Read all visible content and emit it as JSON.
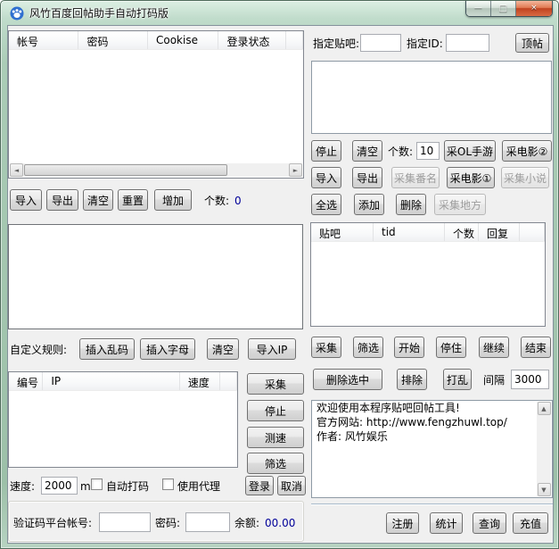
{
  "window": {
    "title": "风竹百度回帖助手自动打码版",
    "controls": {
      "minimize": "—",
      "maximize": "□",
      "close": "×"
    }
  },
  "icons": {
    "scroll_left": "◄",
    "scroll_right": "►",
    "scroll_up": "▲",
    "scroll_down": "▼"
  },
  "left": {
    "account_list": {
      "headers": [
        "帐号",
        "密码",
        "Cookise",
        "登录状态"
      ]
    },
    "account_actions": {
      "import": "导入",
      "export": "导出",
      "clear": "清空",
      "reset": "重置",
      "add": "增加",
      "count_label": "个数:",
      "count_value": "0"
    },
    "rules": {
      "label": "自定义规则:",
      "insert_garbled": "插入乱码",
      "insert_letters": "插入字母",
      "clear": "清空",
      "import_ip": "导入IP"
    },
    "ip_list": {
      "headers": [
        "编号",
        "IP",
        "速度"
      ]
    },
    "ip_actions": {
      "collect": "采集",
      "stop": "停止",
      "speed_test": "测速",
      "filter": "筛选"
    },
    "login_row": {
      "speed_label": "速度:",
      "speed_value": "2000",
      "speed_unit": "ms",
      "auto_captcha_label": "自动打码",
      "use_proxy_label": "使用代理",
      "login": "登录",
      "cancel": "取消"
    },
    "captcha_platform": {
      "account_label": "验证码平台帐号:",
      "password_label": "密码:",
      "balance_label": "余额:",
      "balance_value": "00.00"
    }
  },
  "right": {
    "target": {
      "tieba_label": "指定贴吧:",
      "id_label": "指定ID:",
      "top_button": "顶帖"
    },
    "collect_row1": {
      "stop": "停止",
      "clear": "清空",
      "count_label": "个数:",
      "count_value": "10",
      "collect_ol_mobile": "采OL手游",
      "collect_movie2": "采电影②"
    },
    "collect_row2": {
      "import": "导入",
      "export": "导出",
      "collect_anime": "采集番名",
      "collect_movie1": "采电影①",
      "collect_novel": "采集小说"
    },
    "collect_row3": {
      "select_all": "全选",
      "add": "添加",
      "delete": "删除",
      "collect_place": "采集地方"
    },
    "thread_list": {
      "headers": [
        "贴吧",
        "tid",
        "个数",
        "回复"
      ]
    },
    "run_row": {
      "collect": "采集",
      "filter": "筛选",
      "start": "开始",
      "pause": "停住",
      "resume": "继续",
      "end": "结束"
    },
    "manage_row": {
      "delete_selected": "删除选中",
      "exclude": "排除",
      "shuffle": "打乱",
      "interval_label": "间隔",
      "interval_value": "3000"
    },
    "log": {
      "line1": "欢迎使用本程序贴吧回帖工具!",
      "line2": "官方网站: http://www.fengzhuwl.top/",
      "line3": "作者: 风竹娱乐"
    },
    "account_row": {
      "register": "注册",
      "stats": "统计",
      "query": "查询",
      "recharge": "充值"
    }
  },
  "colors": {
    "accent_navy": "#000099",
    "close_red": "#c04320",
    "frame_green": "#aaccb6"
  }
}
